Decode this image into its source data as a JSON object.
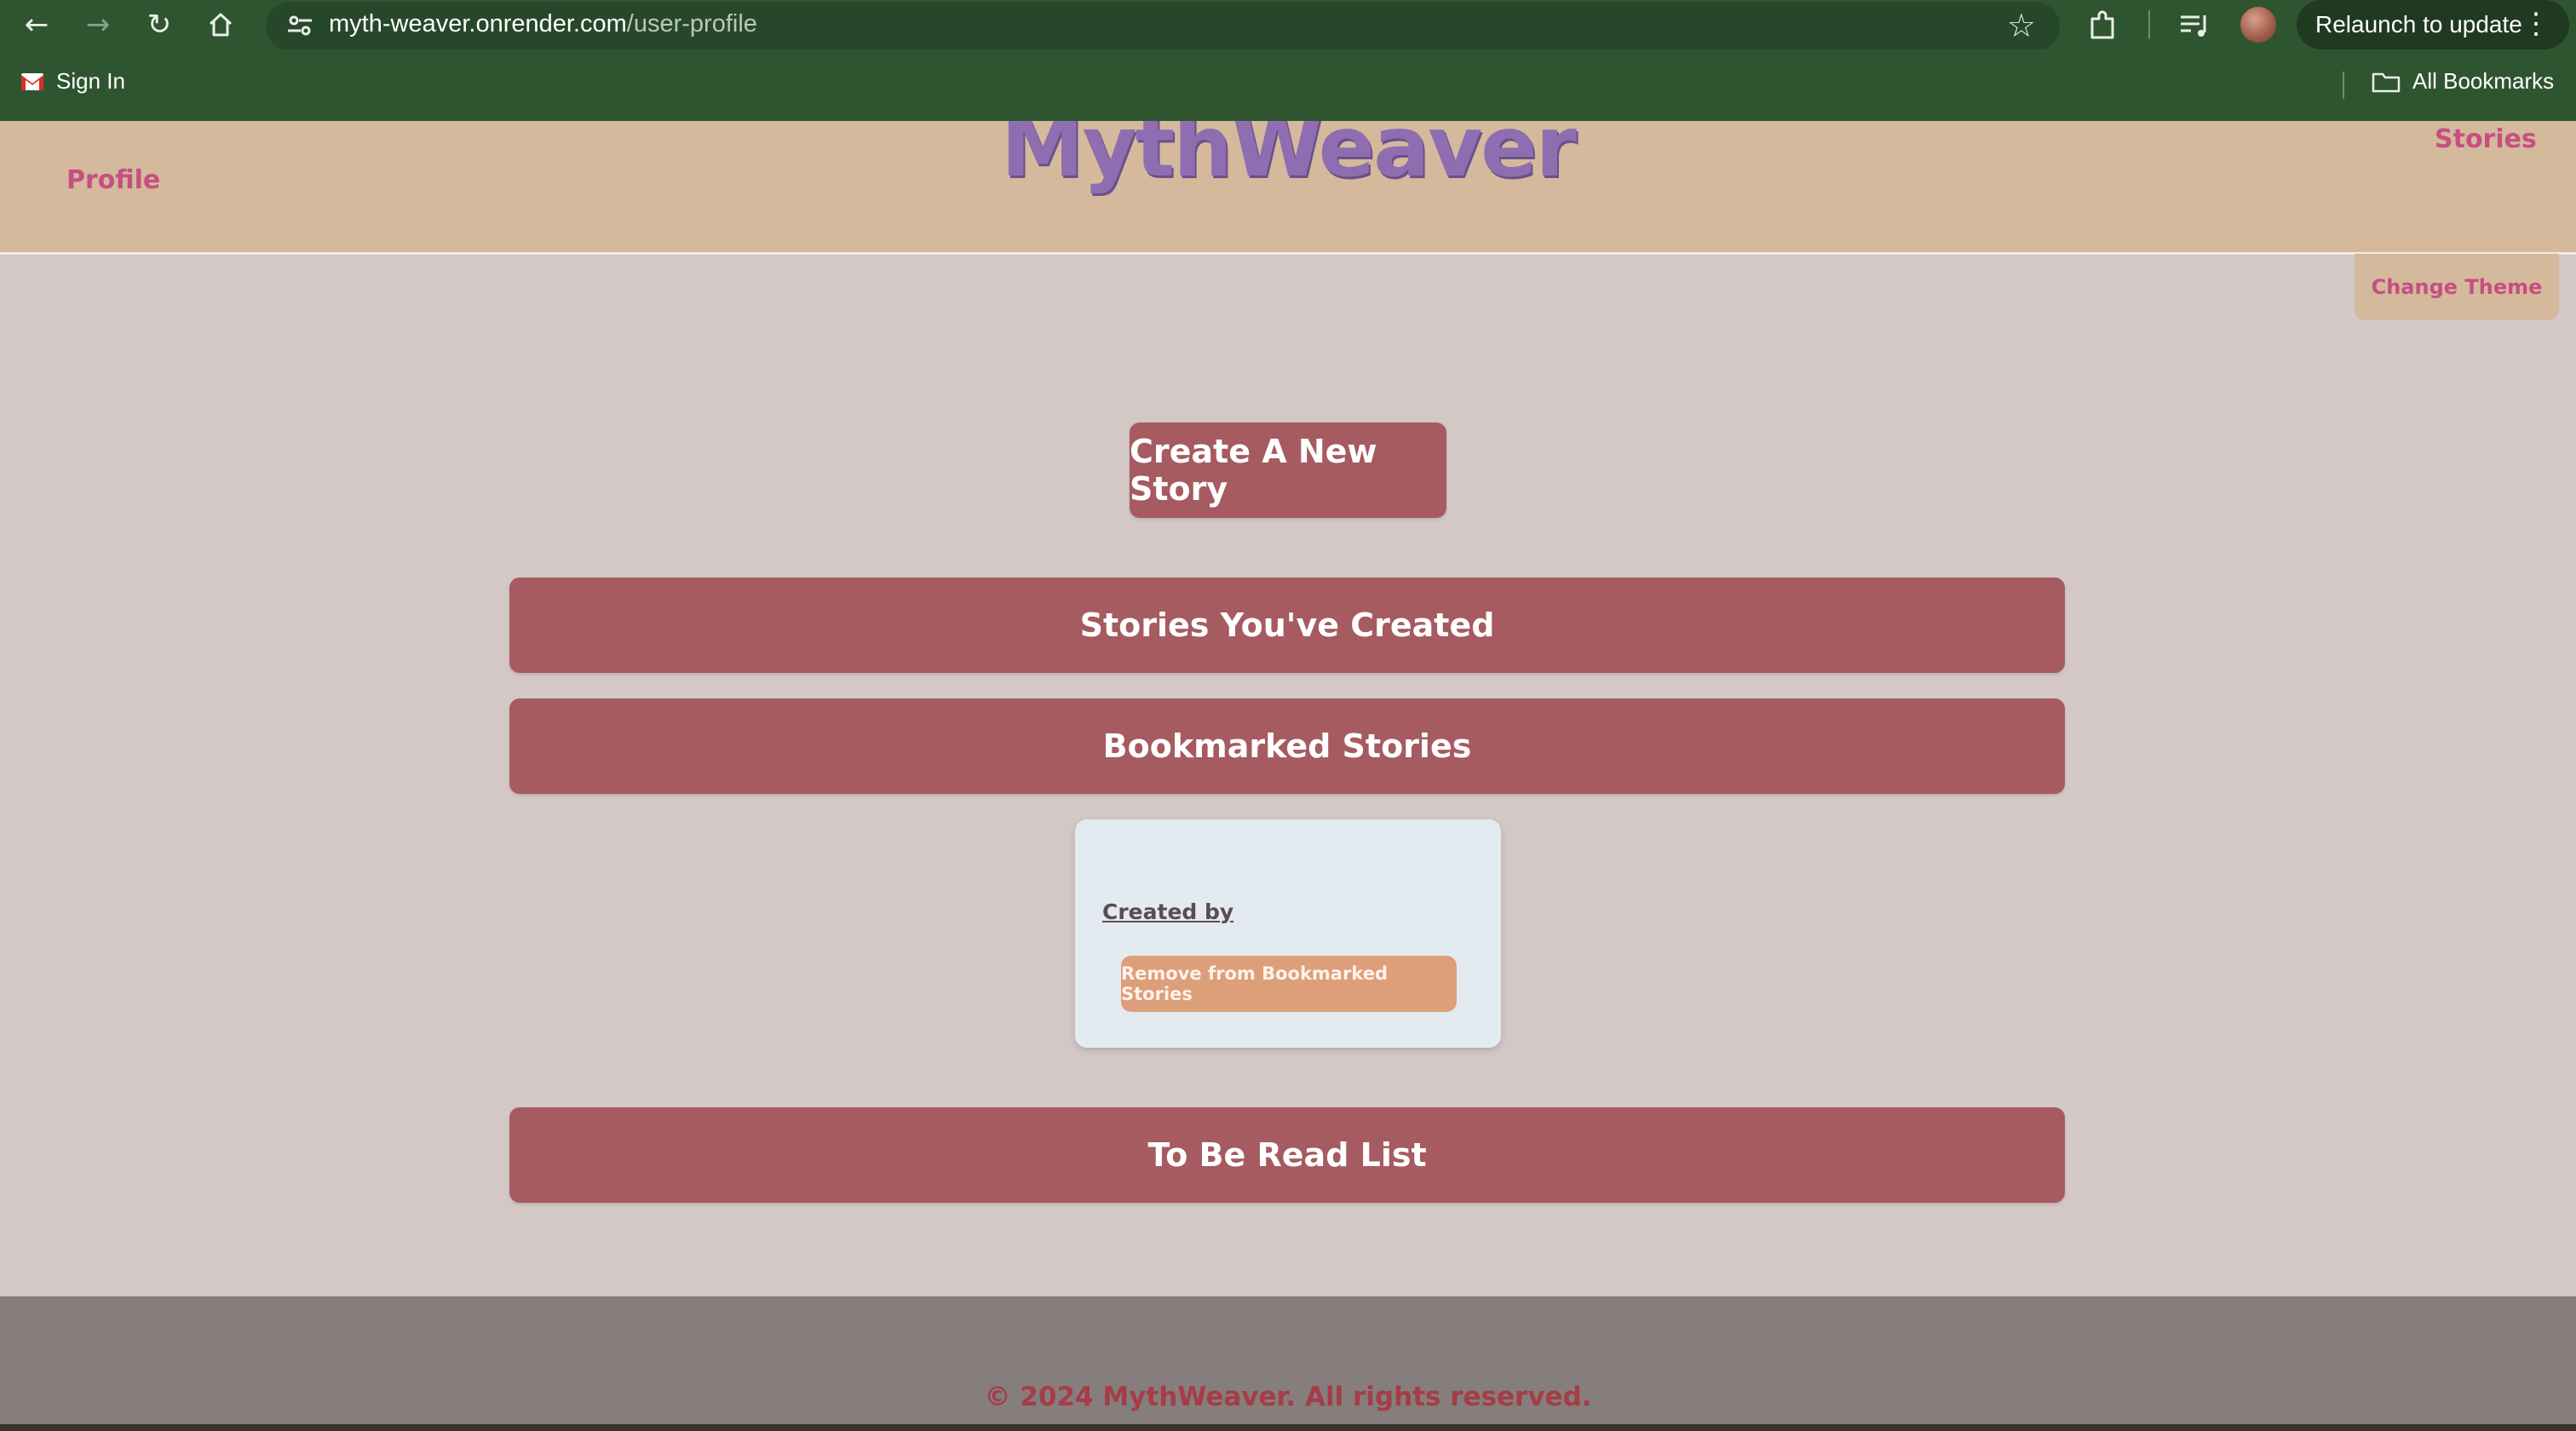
{
  "browser": {
    "url_host": "myth-weaver.onrender.com",
    "url_path": "/user-profile",
    "relaunch_label": "Relaunch to update",
    "icons": {
      "back": "back-arrow-icon",
      "forward": "forward-arrow-icon",
      "reload": "reload-icon",
      "home": "home-icon",
      "site_info": "tune-icon",
      "bookmark": "star-icon",
      "extensions": "puzzle-icon",
      "media": "media-control-icon",
      "menu": "kebab-menu-icon"
    },
    "bookmarks_bar": {
      "signin_label": "Sign In",
      "all_bookmarks_label": "All Bookmarks"
    }
  },
  "header": {
    "logo": "MythWeaver",
    "nav_profile": "Profile",
    "nav_stories": "Stories",
    "theme_button": "Change Theme"
  },
  "main": {
    "create_button": "Create A New Story",
    "sections": {
      "created": "Stories You've Created",
      "bookmarked": "Bookmarked Stories",
      "to_be_read": "To Be Read List"
    },
    "bookmarked_card": {
      "created_by": "Created by",
      "remove_button": "Remove from Bookmarked Stories"
    }
  },
  "footer": {
    "copyright": "© 2024 MythWeaver. All rights reserved."
  },
  "colors": {
    "browser_green": "#2f5530",
    "header_tan": "#d4b99c",
    "page_bg": "#d3c8c6",
    "rose_button": "#a55b60",
    "logo_purple": "#8e6db0",
    "nav_pink": "#c74f80",
    "peach_button": "#dd9e7a",
    "card_bg": "#e3ebf1",
    "footer_gray": "#857e7c",
    "footer_text": "#a63c47"
  }
}
